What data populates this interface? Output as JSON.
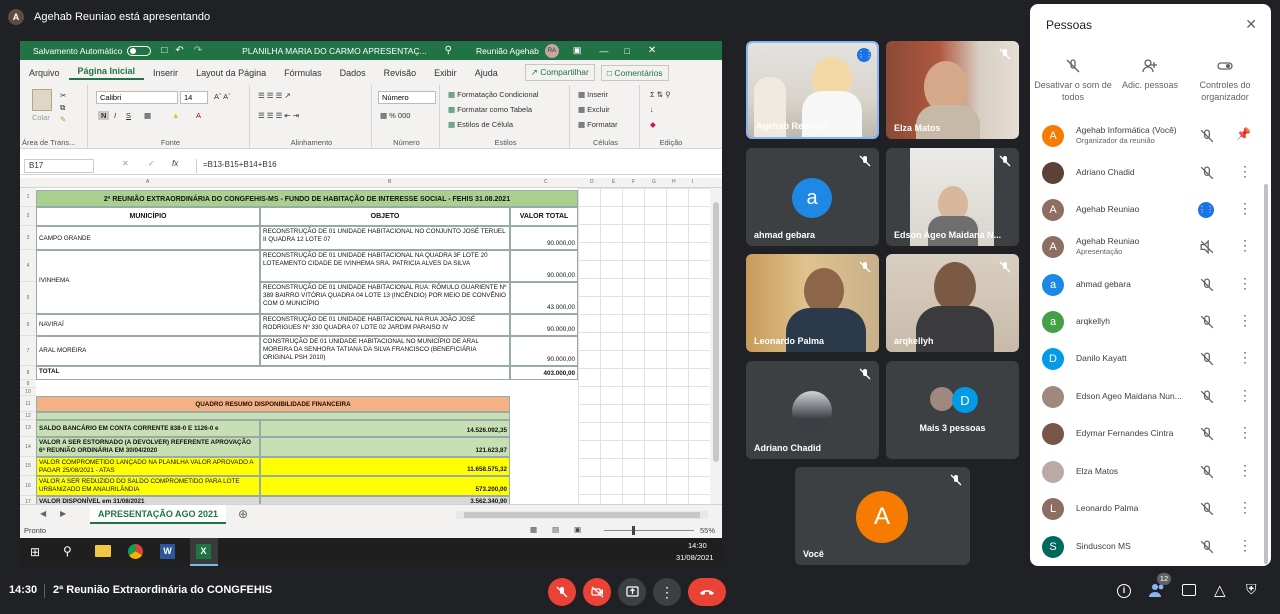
{
  "presenter": {
    "initial": "A",
    "label": "Agehab Reuniao está apresentando"
  },
  "excel": {
    "autosave_label": "Salvamento Automático",
    "doc_title": "PLANILHA MARIA DO CARMO APRESENTAÇ...",
    "user_name": "Reunião Agehab",
    "user_initials": "RA",
    "tabs": [
      "Arquivo",
      "Página Inicial",
      "Inserir",
      "Layout da Página",
      "Fórmulas",
      "Dados",
      "Revisão",
      "Exibir",
      "Ajuda"
    ],
    "share_label": "Compartilhar",
    "comments_label": "Comentários",
    "ribbon": {
      "clipboard": "Área de Trans...",
      "paste": "Colar",
      "font_name": "Calibri",
      "font_size": "14",
      "font_group": "Fonte",
      "align_group": "Alinhamento",
      "number_format": "Número",
      "number_group": "Número",
      "cond_format": "Formatação Condicional",
      "table_format": "Formatar como Tabela",
      "cell_styles": "Estilos de Célula",
      "styles_group": "Estilos",
      "insert": "Inserir",
      "delete": "Excluir",
      "format": "Formatar",
      "cells_group": "Células",
      "edit_group": "Edição"
    },
    "name_box": "B17",
    "formula": "=B13-B15+B14+B16",
    "sheet": {
      "title": "2ª REUNIÃO EXTRAORDINÁRIA DO CONGFEHIS-MS  - FUNDO DE HABITAÇÃO DE INTERESSE SOCIAL - FEHIS 31.08.2021",
      "h_municipio": "MUNICÍPIO",
      "h_objeto": "OBJETO",
      "h_valor": "VALOR TOTAL",
      "rows": [
        {
          "mun": "CAMPO GRANDE",
          "obj": "RECONSTRUÇÃO DE 01 UNIDADE HABITACIONAL NO CONJUNTO JOSÉ TERUEL II QUADRA 12 LOTE 07",
          "val": "90.000,00"
        },
        {
          "mun": "IVINHEMA",
          "obj": "RECONSTRUÇÃO DE 01 UNIDADE HABITACIONAL NA QUADRA 3F LOTE 20 LOTEAMENTO CIDADE DE IVINHEMA SRA. PATRICIA ALVES DA SILVA",
          "val": "90.000,00"
        },
        {
          "mun": "",
          "obj": "RECONSTRUÇÃO DE 01 UNIDADE HABITACIONAL  RUA: RÔMULO GUARIENTE Nº 389 BAIRRO VITÓRIA QUADRA 04 LOTE 13 (INCÊNDIO) POR MEIO DE CONVÊNIO COM O MUNICÍPIO",
          "val": "43.000,00"
        },
        {
          "mun": "NAVIRAÍ",
          "obj": "RECONSTRUÇÃO DE 01 UNIDADE HABITACIONAL NA RUA JOÃO JOSÉ RODRIGUES Nº 330 QUADRA 07 LOTE 02 JARDIM PARAISO IV",
          "val": "90.000,00"
        },
        {
          "mun": "ARAL MOREIRA",
          "obj": "CONSTRUÇÃO DE 01 UNIDADE HABITACIONAL NO MUNICÍPIO DE ARAL MOREIRA DA SENHORA TATIANA DA SILVA FRANCISCO (BENEFICIÁRIA ORIGINAL PSH 2010)",
          "val": "90.000,00"
        }
      ],
      "total_label": "TOTAL",
      "total_value": "403.000,00",
      "summary_title": "QUADRO RESUMO DISPONIBILIDADE FINANCEIRA",
      "summary": [
        {
          "label": "SALDO BANCÁRIO EM CONTA CORRENTE 838-0 E 1126-0 e",
          "value": "14.526.092,35"
        },
        {
          "label": "VALOR A SER ESTORNADO (A DEVOLVER) REFERENTE APROVAÇÃO 6ª REUNIÃO ORDINÁRIA  EM 30/04/2020",
          "value": "121.623,87"
        },
        {
          "label": "VALOR COMPROMETIDO LANÇADO NA PLANILHA VALOR APROVADO A PAGAR 25/08/2021 - ATAS",
          "value": "11.658.575,32"
        },
        {
          "label": "VALOR A SER REDUZIDO DO SALDO COMPROMETIDO PARA LOTE URBANIZADO EM ANAURILÂNDIA",
          "value": "573.200,00"
        },
        {
          "label": "VALOR DISPONÍVEL  em 31/08/2021",
          "value": "3.562.340,90"
        }
      ],
      "row_numbers": [
        "1",
        "2",
        "3",
        "4",
        "5",
        "6",
        "7",
        "8",
        "9",
        "10",
        "11",
        "12",
        "13",
        "14",
        "15",
        "16",
        "17"
      ],
      "col_letters": [
        "A",
        "B",
        "C",
        "D",
        "E",
        "F",
        "G",
        "H",
        "I"
      ]
    },
    "sheet_tab": "APRESENTAÇÃO AGO 2021",
    "status": "Pronto",
    "zoom": "55%",
    "clock_time": "14:30",
    "clock_date": "31/08/2021"
  },
  "tiles": [
    {
      "name": "Agehab Reuniao",
      "type": "video"
    },
    {
      "name": "Elza Matos",
      "type": "video"
    },
    {
      "name": "ahmad gebara",
      "initial": "a",
      "color": "#1e88e5",
      "type": "avatar"
    },
    {
      "name": "Edson Ageo Maidana N...",
      "type": "video"
    },
    {
      "name": "Leonardo Palma",
      "type": "video"
    },
    {
      "name": "arqkellyh",
      "type": "video"
    },
    {
      "name": "Adriano Chadid",
      "type": "photo"
    },
    {
      "name": "Mais 3 pessoas",
      "initial": "D",
      "type": "group"
    },
    {
      "name": "Você",
      "initial": "A",
      "color": "#f57c00",
      "type": "avatar"
    }
  ],
  "people": {
    "title": "Pessoas",
    "actions": [
      {
        "label": "Desativar o som de todos"
      },
      {
        "label": "Adic. pessoas"
      },
      {
        "label": "Controles do organizador"
      }
    ],
    "list": [
      {
        "name": "Agehab Informática (Você)",
        "sub": "Organizador da reunião",
        "initial": "A",
        "color": "#f57c00"
      },
      {
        "name": "Adriano Chadid",
        "sub": "",
        "initial": "",
        "color": "#5d4037"
      },
      {
        "name": "Agehab Reuniao",
        "sub": "",
        "initial": "A",
        "color": "#8d6e63"
      },
      {
        "name": "Agehab Reuniao",
        "sub": "Apresentação",
        "initial": "A",
        "color": "#8d6e63"
      },
      {
        "name": "ahmad gebara",
        "sub": "",
        "initial": "a",
        "color": "#1e88e5"
      },
      {
        "name": "arqkellyh",
        "sub": "",
        "initial": "a",
        "color": "#43a047"
      },
      {
        "name": "Danilo Kayatt",
        "sub": "",
        "initial": "D",
        "color": "#039be5"
      },
      {
        "name": "Edson Ageo Maidana Nun...",
        "sub": "",
        "initial": "",
        "color": "#a1887f"
      },
      {
        "name": "Edymar Fernandes Cintra",
        "sub": "",
        "initial": "",
        "color": "#795548"
      },
      {
        "name": "Elza Matos",
        "sub": "",
        "initial": "",
        "color": "#bcaaa4"
      },
      {
        "name": "Leonardo Palma",
        "sub": "",
        "initial": "L",
        "color": "#8d6e63"
      },
      {
        "name": "Sinduscon MS",
        "sub": "",
        "initial": "S",
        "color": "#00695c"
      }
    ]
  },
  "bottom": {
    "time": "14:30",
    "meeting_title": "2ª Reunião Extraordinária do CONGFEHIS",
    "participants_count": "12"
  }
}
